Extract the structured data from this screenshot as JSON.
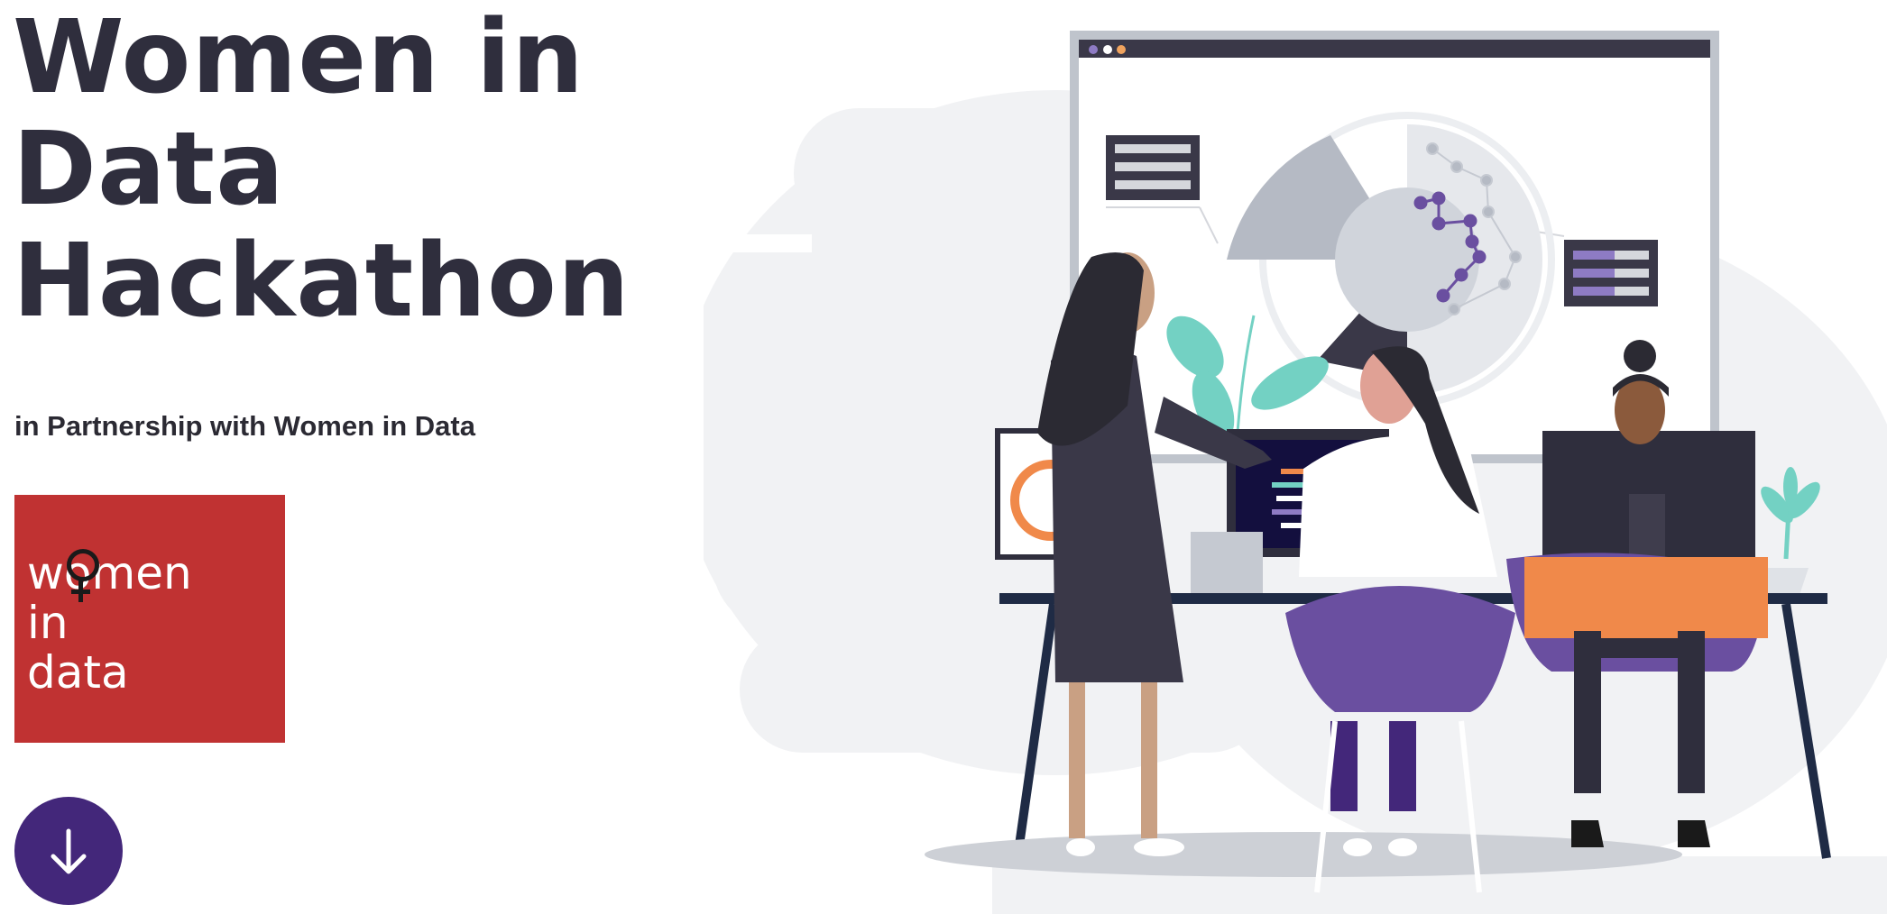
{
  "hero": {
    "title_lines": [
      "Women in",
      "Data",
      "Hackathon"
    ],
    "subtitle": "in Partnership with Women in Data"
  },
  "logo": {
    "lines": [
      "women",
      "in",
      "data"
    ],
    "background": "#c03232"
  },
  "scroll_button": {
    "icon": "arrow-down-icon",
    "color": "#43277a"
  },
  "illustration": {
    "description_icon": "team-working-illustration"
  }
}
